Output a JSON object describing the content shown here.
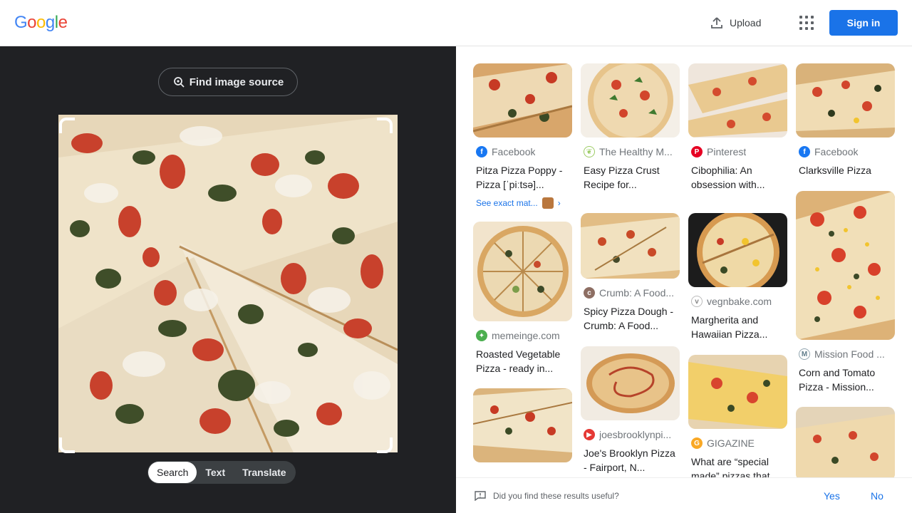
{
  "header": {
    "logo_letters": [
      "G",
      "o",
      "o",
      "g",
      "l",
      "e"
    ],
    "logo_colors": [
      "#4285f4",
      "#ea4335",
      "#fbbc05",
      "#4285f4",
      "#34a853",
      "#ea4335"
    ],
    "upload_label": "Upload",
    "signin_label": "Sign in"
  },
  "lens": {
    "find_source_label": "Find image source",
    "tabs": [
      {
        "label": "Search",
        "active": true
      },
      {
        "label": "Text",
        "active": false
      },
      {
        "label": "Translate",
        "active": false
      }
    ]
  },
  "results": {
    "columns": [
      [
        {
          "source": "Facebook",
          "favicon": "facebook-icon",
          "favicon_color": "#1877f2",
          "title": "Pitza Pizza Poppy - Pizza [ˈpiːtsə]...",
          "exact_match": "See exact mat..."
        },
        {
          "source": "memeinge.com",
          "favicon": "leaf-icon",
          "favicon_color": "#4caf50",
          "title": "Roasted Vegetable Pizza - ready in..."
        },
        {
          "source": "",
          "favicon": "",
          "favicon_color": "",
          "title": ""
        }
      ],
      [
        {
          "source": "The Healthy M...",
          "favicon": "leaf-icon",
          "favicon_color": "#9ccc65",
          "title": "Easy Pizza Crust Recipe for..."
        },
        {
          "source": "Crumb: A Food...",
          "favicon": "crumb-icon",
          "favicon_color": "#8d6e63",
          "title": "Spicy Pizza Dough - Crumb: A Food..."
        },
        {
          "source": "joesbrooklynpi...",
          "favicon": "joes-icon",
          "favicon_color": "#e53935",
          "title": "Joe's Brooklyn Pizza - Fairport, N..."
        }
      ],
      [
        {
          "source": "Pinterest",
          "favicon": "pinterest-icon",
          "favicon_color": "#e60023",
          "title": "Cibophilia: An obsession with..."
        },
        {
          "source": "vegnbake.com",
          "favicon": "vegnbake-icon",
          "favicon_color": "#9e9e9e",
          "title": "Margherita and Hawaiian Pizza..."
        },
        {
          "source": "GIGAZINE",
          "favicon": "gigazine-icon",
          "favicon_color": "#f9a825",
          "title": "What are “special made” pizzas that..."
        }
      ],
      [
        {
          "source": "Facebook",
          "favicon": "facebook-icon",
          "favicon_color": "#1877f2",
          "title": "Clarksville Pizza"
        },
        {
          "source": "Mission Food ...",
          "favicon": "mission-icon",
          "favicon_color": "#90a4ae",
          "title": "Corn and Tomato Pizza - Mission..."
        },
        {
          "source": "",
          "favicon": "",
          "favicon_color": "",
          "title": ""
        }
      ]
    ]
  },
  "feedback": {
    "question": "Did you find these results useful?",
    "yes_label": "Yes",
    "no_label": "No"
  }
}
